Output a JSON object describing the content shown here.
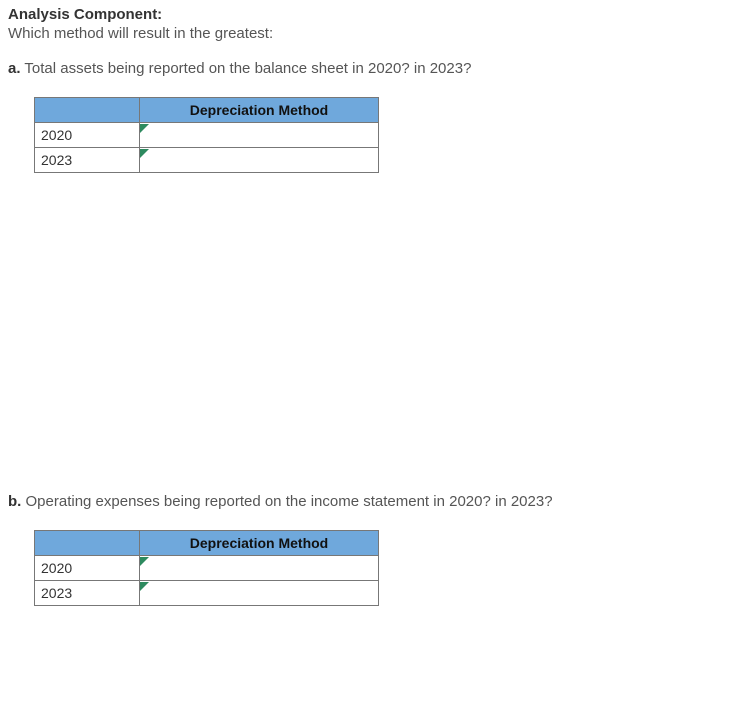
{
  "heading": "Analysis Component:",
  "subheading": "Which method will result in the greatest:",
  "questions": {
    "a": {
      "letter": "a.",
      "text": "Total assets being reported on the balance sheet in 2020? in 2023?",
      "table": {
        "header_blank": "",
        "header_method": "Depreciation Method",
        "rows": [
          {
            "year": "2020",
            "value": ""
          },
          {
            "year": "2023",
            "value": ""
          }
        ]
      }
    },
    "b": {
      "letter": "b.",
      "text": "Operating expenses being reported on the income statement in 2020? in 2023?",
      "table": {
        "header_blank": "",
        "header_method": "Depreciation Method",
        "rows": [
          {
            "year": "2020",
            "value": ""
          },
          {
            "year": "2023",
            "value": ""
          }
        ]
      }
    }
  }
}
